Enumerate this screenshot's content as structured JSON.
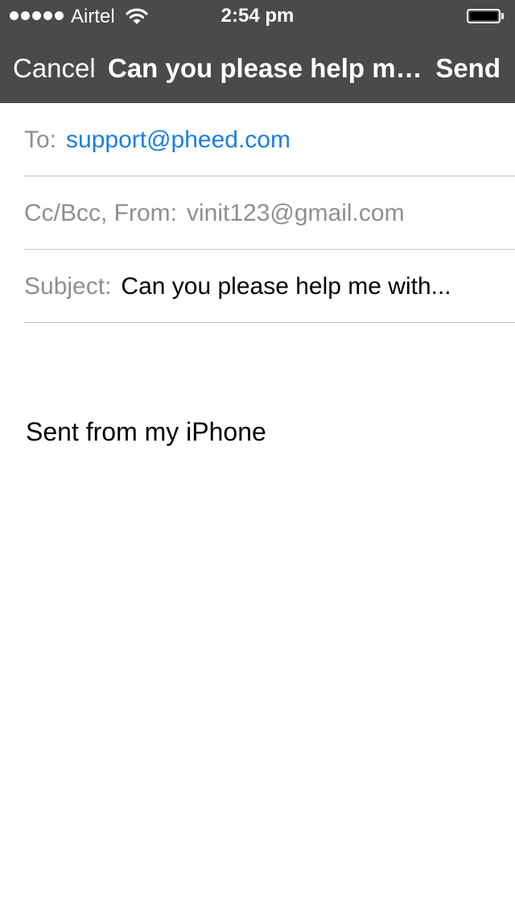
{
  "status_bar": {
    "carrier": "Airtel",
    "time": "2:54 pm",
    "signal_dots": 5,
    "battery_level": 1.0
  },
  "nav": {
    "cancel_label": "Cancel",
    "title": "Can you please help me with...",
    "send_label": "Send"
  },
  "compose": {
    "to_label": "To:",
    "to_value": "support@pheed.com",
    "cc_label": "Cc/Bcc, From:",
    "from_value": "vinit123@gmail.com",
    "subject_label": "Subject:",
    "subject_value": "Can you please help me with...",
    "body_signature": "Sent from my iPhone"
  },
  "colors": {
    "nav_background": "#4a4a4a",
    "link_blue": "#1a7ee6",
    "label_gray": "#8e8e93"
  }
}
